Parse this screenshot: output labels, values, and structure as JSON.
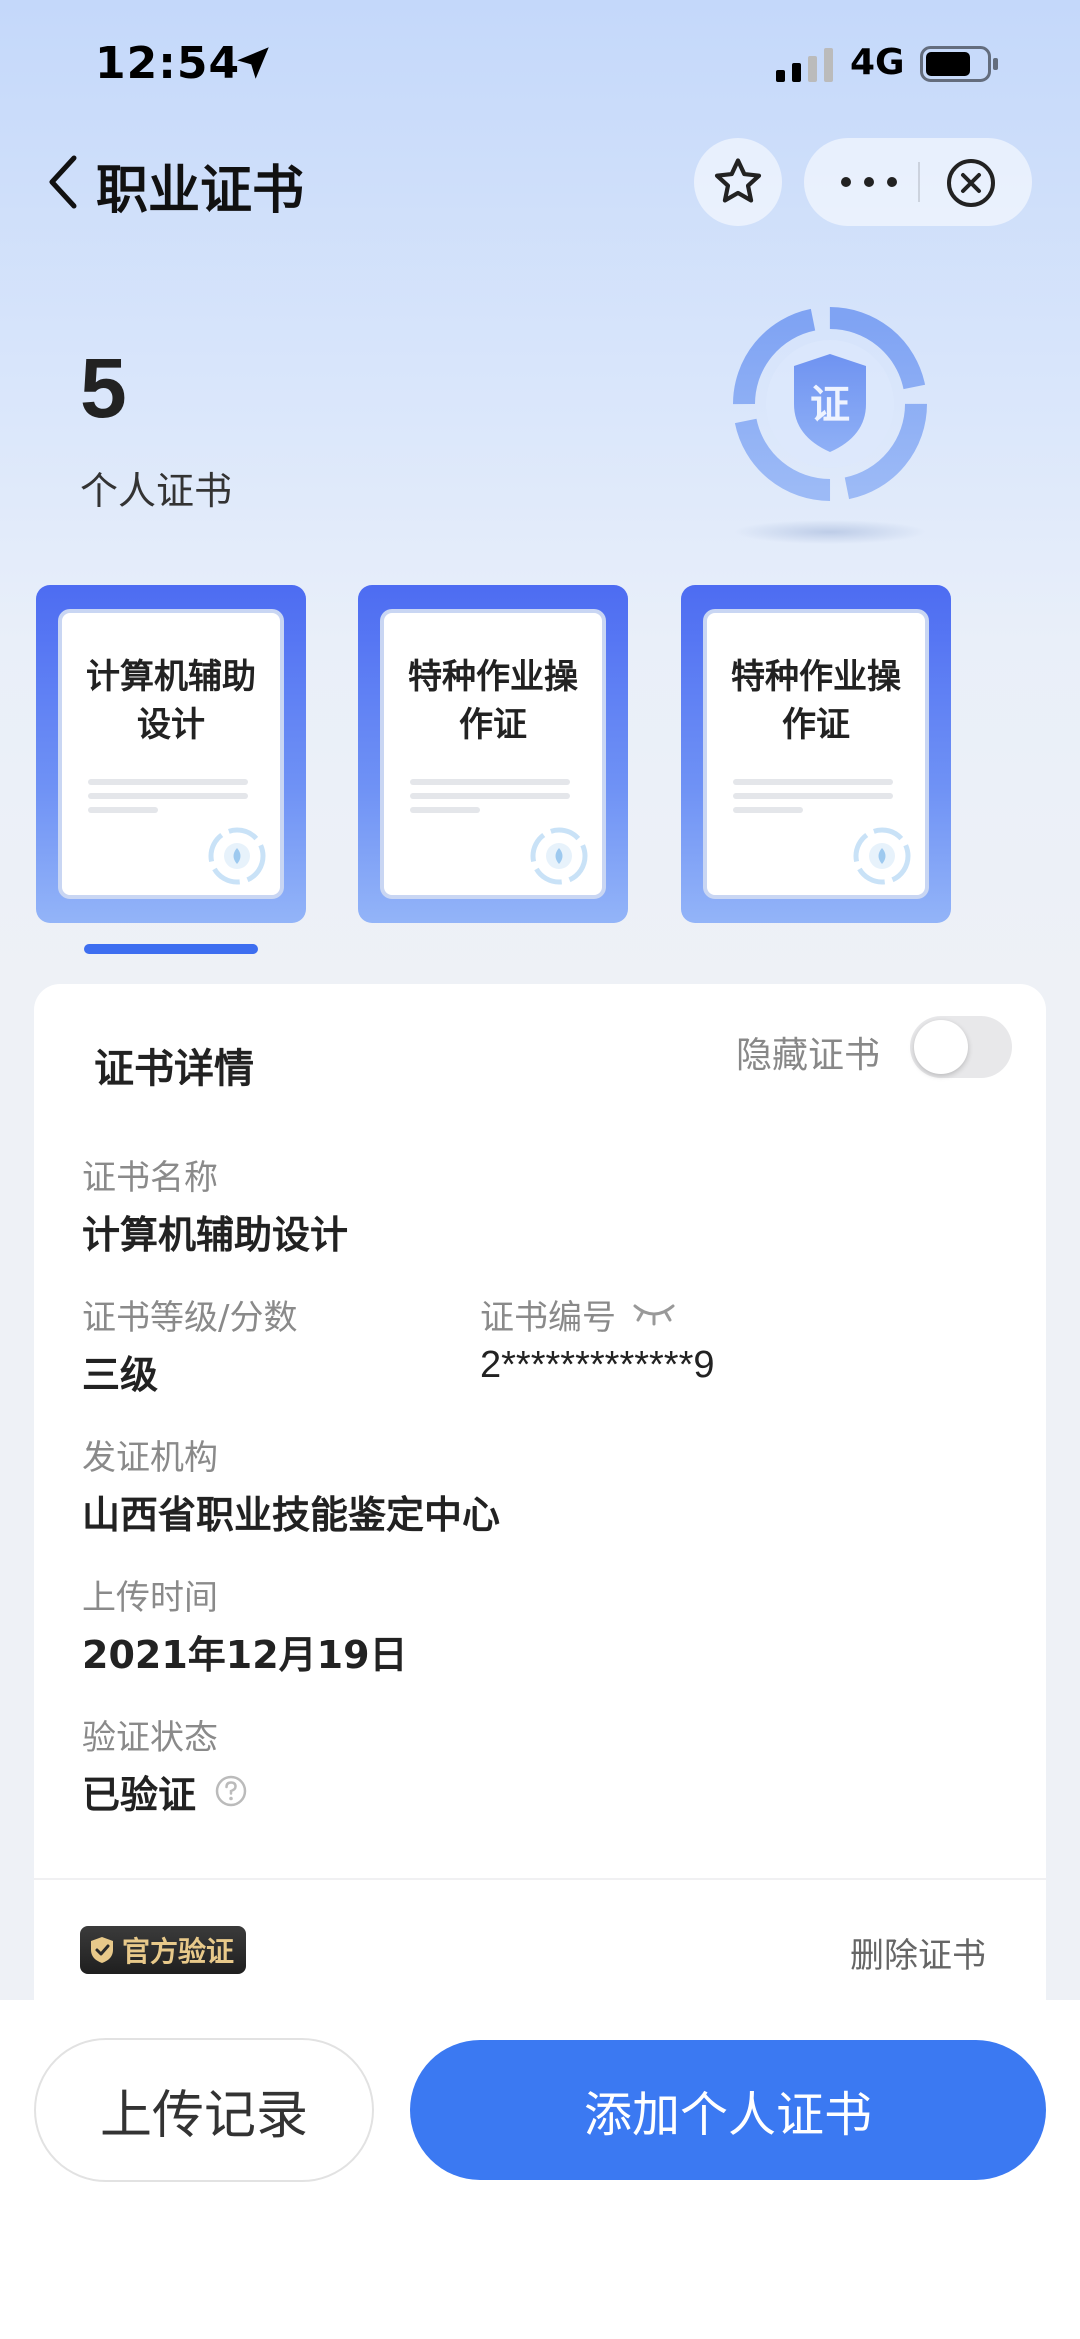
{
  "status_bar": {
    "time": "12:54",
    "network": "4G"
  },
  "nav": {
    "title": "职业证书"
  },
  "summary": {
    "count": "5",
    "label": "个人证书",
    "emblem_text": "证"
  },
  "cards": [
    {
      "title": "计算机辅助设计"
    },
    {
      "title": "特种作业操作证"
    },
    {
      "title": "特种作业操作证"
    }
  ],
  "detail": {
    "title": "证书详情",
    "hide_label": "隐藏证书",
    "hide_enabled": false,
    "name_label": "证书名称",
    "name_value": "计算机辅助设计",
    "level_label": "证书等级/分数",
    "level_value": "三级",
    "number_label": "证书编号",
    "number_value": "2*************9",
    "issuer_label": "发证机构",
    "issuer_value": "山西省职业技能鉴定中心",
    "upload_label": "上传时间",
    "upload_value": "2021年12月19日",
    "verify_label": "验证状态",
    "verify_value": "已验证",
    "official_badge": "官方验证",
    "delete_label": "删除证书"
  },
  "actions": {
    "history": "上传记录",
    "add": "添加个人证书"
  },
  "colors": {
    "primary": "#3b79f2",
    "card_blue": "#4d6cf2",
    "indicator": "#3d6ef0"
  }
}
